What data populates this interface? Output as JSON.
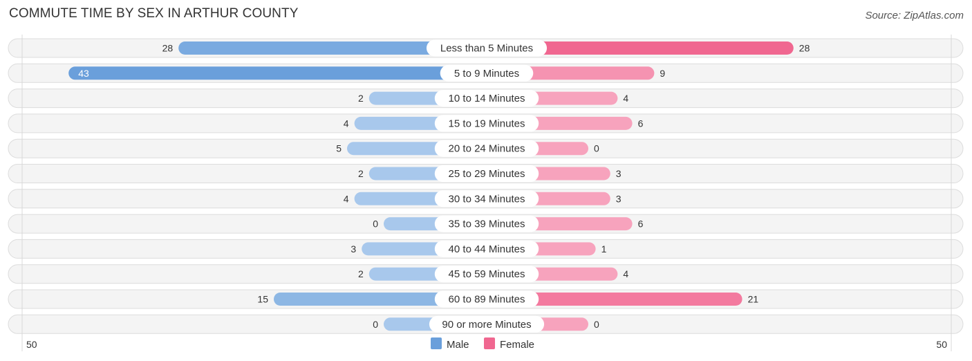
{
  "title": "COMMUTE TIME BY SEX IN ARTHUR COUNTY",
  "source": "Source: ZipAtlas.com",
  "colors": {
    "male": "#6a9fdb",
    "male_light": "#a8c8ec",
    "female": "#f06790",
    "female_light": "#f7a3bd"
  },
  "chart_data": {
    "type": "bar",
    "orientation": "horizontal-diverging",
    "title": "COMMUTE TIME BY SEX IN ARTHUR COUNTY",
    "categories": [
      "Less than 5 Minutes",
      "5 to 9 Minutes",
      "10 to 14 Minutes",
      "15 to 19 Minutes",
      "20 to 24 Minutes",
      "25 to 29 Minutes",
      "30 to 34 Minutes",
      "35 to 39 Minutes",
      "40 to 44 Minutes",
      "45 to 59 Minutes",
      "60 to 89 Minutes",
      "90 or more Minutes"
    ],
    "series": [
      {
        "name": "Male",
        "values": [
          28,
          43,
          2,
          4,
          5,
          2,
          4,
          0,
          3,
          2,
          15,
          0
        ]
      },
      {
        "name": "Female",
        "values": [
          28,
          9,
          4,
          6,
          0,
          3,
          3,
          6,
          1,
          4,
          21,
          0
        ]
      }
    ],
    "xlim": [
      -50,
      50
    ],
    "axis_tick_labels": {
      "left": "50",
      "right": "50"
    },
    "legend": {
      "entries": [
        "Male",
        "Female"
      ],
      "placement": "bottom-center"
    },
    "grid": false
  }
}
